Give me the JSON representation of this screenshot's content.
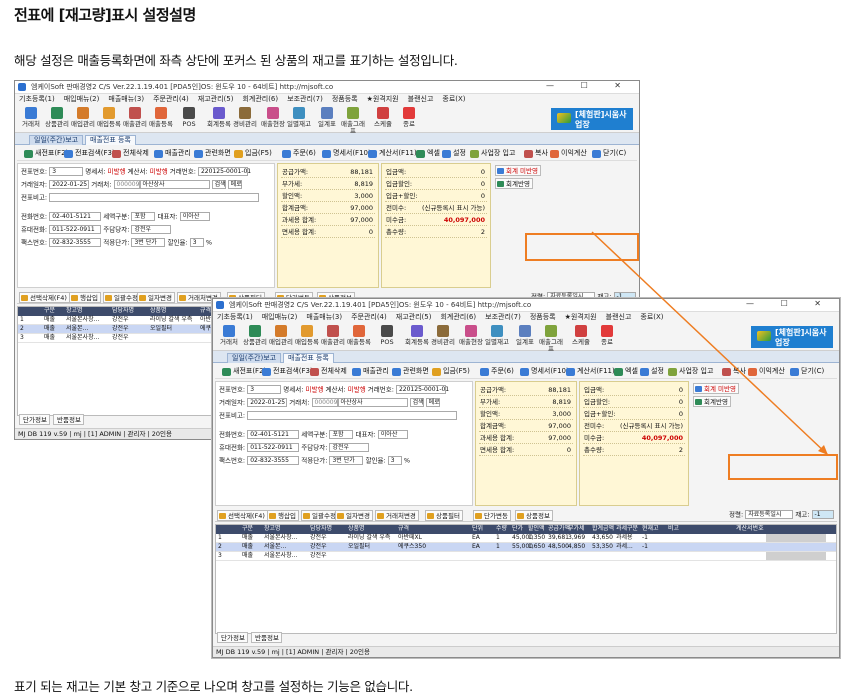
{
  "doc": {
    "title": "전표에 [재고량]표시 설정설명",
    "intro": "해당 설정은 매출등록화면에 좌측 상단에 포커스 된 상품의 재고를 표기하는 설정입니다.",
    "footer": "표기 되는 재고는 기본 창고 기준으로 나오며 창고를 설정하는 기능은 없습니다."
  },
  "window": {
    "title": "엠케이Soft 판매경영2 C/S  Ver.22.1.19.401  [PDA5인]OS: 윈도우 10 - 64비트]   http://mjsoft.co",
    "title_b": "엠케이Soft 판매경영2 C/S  Ver.22.1.19.401  [PDA5인]OS: 윈도우 10 - 64비트]   http://mjsoft.co",
    "controls": "— ☐ ✕",
    "menu": [
      "기초등록(1)",
      "매입매뉴(2)",
      "매출매뉴(3)",
      "주문관리(4)",
      "재고관리(5)",
      "회계관리(6)",
      "보조관리(7)",
      "정품등록",
      "★원격지원",
      "블랜신고",
      "종료(X)"
    ],
    "toolbar": [
      "거래처",
      "상품관리",
      "매입관리",
      "매입등록",
      "매출관리",
      "매출등록",
      "POS",
      "회계등록",
      "경비관리",
      "매출현장",
      "일별재고",
      "일계표",
      "매출그래프",
      "스케쥴",
      "종료"
    ],
    "toolbar_colors": [
      "#3a7bd5",
      "#2e8b57",
      "#d47b2a",
      "#e29a2e",
      "#c0504d",
      "#e0663a",
      "#4a4a4a",
      "#6a5acd",
      "#8b6b3a",
      "#c94e8a",
      "#3e8fc0",
      "#5b7fbf",
      "#7fa33c",
      "#d04040",
      "#e23a3a"
    ],
    "logo": "[체험판]시움사업장",
    "tabs": [
      "일일(주간)보고",
      "매출전표 등록"
    ],
    "actions": [
      "새전표(F2)",
      "전표검색(F3)",
      "전체삭제",
      "매출관리",
      "관련화면",
      "입금(F5)",
      "주문(6)",
      "명세서(F10)",
      "계산서(F11)",
      "엑셀",
      "설정",
      "사업장 입고",
      "복사",
      "이익계산",
      "닫기(C)"
    ],
    "form": {
      "slip_no_label": "전표번호:",
      "slip_no": "3",
      "statement_label": "명세서:",
      "statement": "미발행",
      "invoice_label": "계산서:",
      "invoice": "미발행",
      "trade_no_label": "거래번호:",
      "trade_no": "220125-0001-01",
      "date_label": "거래일자:",
      "date": "2022-01-25",
      "customer_label": "거래처:",
      "customer_code": "000009",
      "customer_name": "아산상사",
      "note_label": "전표비고:",
      "phone_label": "전화번호:",
      "phone": "02-401-5121",
      "tax_type_label": "세액구분:",
      "tax_type": "포함",
      "ceo_label": "대표자:",
      "ceo": "이아산",
      "mobile_label": "휴대전화:",
      "mobile": "011-522-0911",
      "manager_label": "주담당자:",
      "manager": "강전우",
      "fax_label": "팩스번호:",
      "fax": "02-832-3555",
      "price_label": "적용단가:",
      "price": "3번 단가",
      "discount_label": "할인율:",
      "discount": "3",
      "btn_search": "검색",
      "btn_edit": "메로"
    },
    "summary": [
      {
        "label": "공급가액:",
        "value": "88,181"
      },
      {
        "label": "부가세:",
        "value": "8,819"
      },
      {
        "label": "할인액:",
        "value": "3,000"
      },
      {
        "label": "합계금액:",
        "value": "97,000"
      },
      {
        "label": "과세용 합계:",
        "value": "97,000"
      },
      {
        "label": "면세용 합계:",
        "value": "0"
      }
    ],
    "summary2": [
      {
        "label": "입금액:",
        "value": "0"
      },
      {
        "label": "입금할인:",
        "value": "0"
      },
      {
        "label": "입금+할인:",
        "value": "0"
      },
      {
        "label": "전미수:",
        "value": "(신규등록시 표시 가능)"
      },
      {
        "label": "미수금:",
        "value": "40,097,000"
      },
      {
        "label": "총수량:",
        "value": "2"
      }
    ],
    "side": {
      "print": "회계 미반영",
      "ledger": "회계반영"
    },
    "bottom_actions": [
      "선택삭제(F4)",
      "행삽입",
      "일괄수정",
      "일자변경",
      "거래처변경",
      "상품필터",
      "단가변동",
      "상품정보"
    ],
    "stock": {
      "sort_label": "정렬:",
      "sort_value": "자료등록일시",
      "stock_label": "재고:",
      "stock_value": "-1"
    },
    "grid_headers": [
      "",
      "구분",
      "창고명",
      "담당자명",
      "상품명",
      "규격",
      "단위",
      "수량",
      "단가",
      "할인액",
      "공급가액",
      "부가세",
      "합계금액",
      "과세구분",
      "현재고",
      "비고",
      "계산서번호"
    ],
    "rows": [
      {
        "no": "1",
        "type": "매출",
        "store": "서울본사창...",
        "manager": "강전우",
        "product": "라이닝 갈색 우측",
        "spec": "아반떼XL",
        "unit": "EA",
        "qty": "1",
        "price": "45,000",
        "disc": "1,350",
        "supply": "39,681",
        "vat": "3,969",
        "total": "43,650",
        "tax": "과세용",
        "stock": "-1"
      },
      {
        "no": "2",
        "type": "매출",
        "store": "서울본...",
        "manager": "강전우",
        "product": "오일필터",
        "spec": "에쿠스350",
        "unit": "EA",
        "qty": "1",
        "price": "55,000",
        "disc": "1,650",
        "supply": "48,500",
        "vat": "4,850",
        "total": "53,350",
        "tax": "과세...",
        "stock": "-1"
      },
      {
        "no": "3",
        "type": "매출",
        "store": "서울본사창...",
        "manager": "강전우",
        "product": "",
        "spec": "",
        "unit": "",
        "qty": "",
        "price": "",
        "disc": "",
        "supply": "",
        "vat": "",
        "total": "",
        "tax": "",
        "stock": ""
      }
    ],
    "footer_buttons": [
      "단가정보",
      "반품정보"
    ],
    "footer_right": "동일상품처리(F7):",
    "status": "MJ DB 119 v.59 | mj | [1] ADMIN | 관리자 | 20인용",
    "accent": "#ee7d22"
  }
}
